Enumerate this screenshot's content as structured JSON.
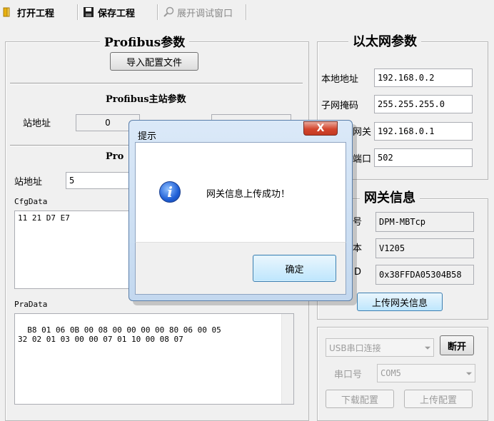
{
  "toolbar": {
    "open_label": "打开工程",
    "save_label": "保存工程",
    "debug_label": "展开调试窗口"
  },
  "profibus": {
    "group_title": "Profibus参数",
    "import_label": "导入配置文件",
    "master_title": "Profibus主站参数",
    "master_addr_label": "站地址",
    "master_addr_value": "0",
    "slave_title_partial": "Pro",
    "slave_addr_label": "站地址",
    "slave_addr_value": "5",
    "cfg_label": "CfgData",
    "cfg_value": "11 21 D7 E7",
    "pra_label": "PraData",
    "pra_value": "B8 01 06 0B 00 08 00 00 00 00 80 06 00 05\n32 02 01 03 00 00 07 01 10 00 08 07"
  },
  "ethernet": {
    "group_title": "以太网参数",
    "local_addr_label": "本地地址",
    "local_addr_value": "192.168.0.2",
    "mask_label": "子网掩码",
    "mask_value": "255.255.255.0",
    "gateway_label_partial": "网关",
    "gateway_value": "192.168.0.1",
    "port_label_partial": "端口",
    "port_value": "502"
  },
  "gateway_info": {
    "group_title": "网关信息",
    "model_label_partial": "号",
    "model_value": "DPM-MBTcp",
    "version_label_partial": "本",
    "version_value": "V1205",
    "id_label_partial": "D",
    "id_value": "0x38FFDA05304B58",
    "upload_label": "上传网关信息"
  },
  "connection": {
    "usb_select": "USB串口连接",
    "disconnect_label": "断开",
    "com_label": "串口号",
    "com_value": "COM5",
    "download_label": "下载配置",
    "upload_label": "上传配置"
  },
  "dialog": {
    "title": "提示",
    "close_symbol": "X",
    "message": "网关信息上传成功！",
    "ok_label": "确定"
  }
}
